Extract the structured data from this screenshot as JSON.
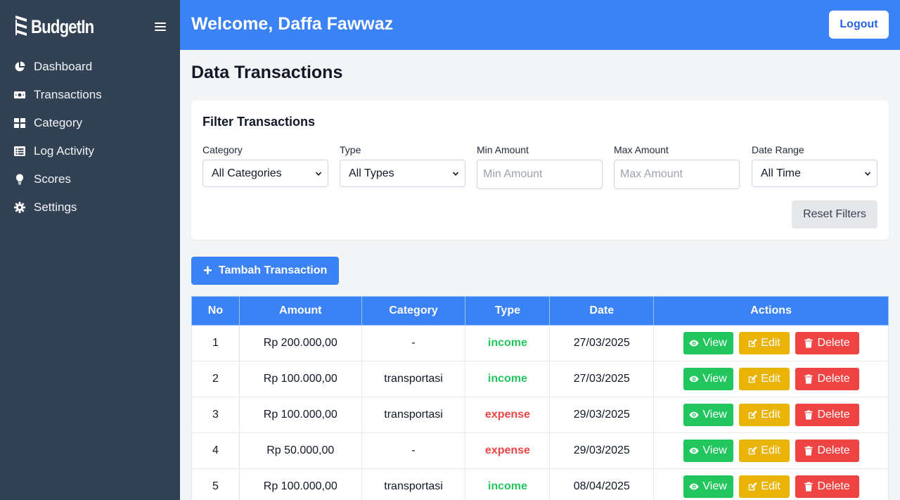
{
  "brand": {
    "name": "BudgetIn"
  },
  "sidebar": {
    "items": [
      {
        "label": "Dashboard",
        "icon": "chart-pie-icon"
      },
      {
        "label": "Transactions",
        "icon": "money-bill-icon"
      },
      {
        "label": "Category",
        "icon": "grid-icon"
      },
      {
        "label": "Log Activity",
        "icon": "list-icon"
      },
      {
        "label": "Scores",
        "icon": "lightbulb-icon"
      },
      {
        "label": "Settings",
        "icon": "gear-icon"
      }
    ]
  },
  "header": {
    "welcome": "Welcome, Daffa Fawwaz",
    "logout": "Logout"
  },
  "page": {
    "title": "Data Transactions"
  },
  "filter": {
    "title": "Filter Transactions",
    "category_label": "Category",
    "category_value": "All Categories",
    "type_label": "Type",
    "type_value": "All Types",
    "min_label": "Min Amount",
    "min_placeholder": "Min Amount",
    "max_label": "Max Amount",
    "max_placeholder": "Max Amount",
    "date_label": "Date Range",
    "date_value": "All Time",
    "reset": "Reset Filters"
  },
  "add_button": "Tambah Transaction",
  "table": {
    "headers": [
      "No",
      "Amount",
      "Category",
      "Type",
      "Date",
      "Actions"
    ],
    "action_labels": {
      "view": "View",
      "edit": "Edit",
      "delete": "Delete"
    },
    "rows": [
      {
        "no": "1",
        "amount": "Rp 200.000,00",
        "category": "-",
        "type": "income",
        "date": "27/03/2025"
      },
      {
        "no": "2",
        "amount": "Rp 100.000,00",
        "category": "transportasi",
        "type": "income",
        "date": "27/03/2025"
      },
      {
        "no": "3",
        "amount": "Rp 100.000,00",
        "category": "transportasi",
        "type": "expense",
        "date": "29/03/2025"
      },
      {
        "no": "4",
        "amount": "Rp 50.000,00",
        "category": "-",
        "type": "expense",
        "date": "29/03/2025"
      },
      {
        "no": "5",
        "amount": "Rp 100.000,00",
        "category": "transportasi",
        "type": "income",
        "date": "08/04/2025"
      }
    ]
  },
  "colors": {
    "sidebar": "#334155",
    "primary": "#3b82f6",
    "income": "#22c55e",
    "expense": "#ef4444",
    "edit": "#eab308"
  }
}
